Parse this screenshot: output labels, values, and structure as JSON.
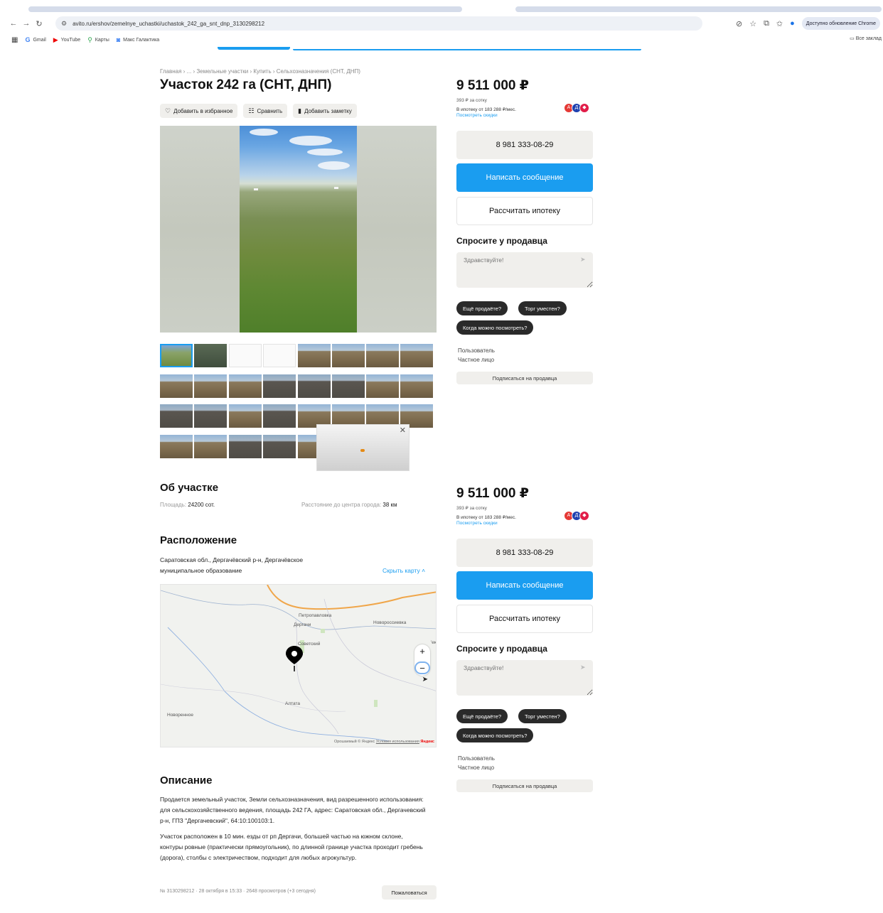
{
  "browser": {
    "url": "avito.ru/ershov/zemelnye_uchastki/uchastok_242_ga_snt_dnp_3130298212",
    "update_label": "Доступно обновление Chrome",
    "bookmarks": [
      "Gmail",
      "YouTube",
      "Карты",
      "Макс Галактика"
    ],
    "all_bookmarks": "Все заклад"
  },
  "listing": {
    "breadcrumbs": "Главная › ... › Земельные участки › Купить › Сельхозназначения (СНТ, ДНП)",
    "title": "Участок 242 га (СНТ, ДНП)",
    "actions": {
      "favorite": "Добавить в избранное",
      "compare": "Сравнить",
      "note": "Добавить заметку"
    }
  },
  "about": {
    "heading": "Об участке",
    "area_label": "Площадь:",
    "area_value": "24200 сот.",
    "distance_label": "Расстояние до центра города:",
    "distance_value": "38 км"
  },
  "location": {
    "heading": "Расположение",
    "address": "Саратовская обл., Дергачёвский р-н, Дергачёвское муниципальное образование",
    "hide_map": "Скрыть карту ˄",
    "towns": {
      "petropavlovka": "Петропавловка",
      "dergachi": "Дергачи",
      "novorossiyka": "Новороссиевка",
      "sovetsky": "Советский",
      "altata": "Алтата",
      "novopetnoe": "Новоренное",
      "edge": "'ек"
    },
    "map_footer": {
      "copyright": "Орошаемый © Яндекс",
      "terms": "Условия использования",
      "brand": "Яндекс"
    },
    "zoom_in": "+",
    "zoom_out": "−"
  },
  "description": {
    "heading": "Описание",
    "p1": "Продается земельный участок, Земли сельхозназначения, вид разрешенного использования: для сельскохозяйственного ведения, площадь 242 ГА, адрес: Саратовская обл., Дергачевский р-н, ГПЗ \"Дергачевский\", 64:10:100103:1.",
    "p2": "Участок расположен в 10 мин. езды от рп Дергачи, большей частью на южном склоне, контуры ровные (практически прямоугольник), по длинной границе участка проходит гребень (дорога), столбы с электричеством, подходит для любых агрокультур."
  },
  "meta": {
    "info": "№ 3130298212 · 28 октября в 15:33 · 2648 просмотров (+3 сегодня)",
    "report": "Пожаловаться"
  },
  "sidebar": {
    "price": "9 511 000 ₽",
    "per_sotka": "393 ₽ за сотку",
    "mortgage": "В ипотеку от 183 288 ₽/мес.",
    "discounts": "Посмотреть скидки",
    "phone": "8 981 333-08-29",
    "write": "Написать сообщение",
    "calc_mortgage": "Рассчитать ипотеку",
    "ask_title": "Спросите у продавца",
    "ask_placeholder": "Здравствуйте!",
    "q1": "Ещё продаёте?",
    "q2": "Торг уместен?",
    "q3": "Когда можно посмотреть?",
    "seller_role": "Пользователь",
    "seller_type": "Частное лицо",
    "subscribe": "Подписаться на продавца"
  },
  "colors": {
    "accent": "#1a9df0",
    "chip_bg": "#f0efec",
    "dark_chip": "#2a2a2a"
  }
}
